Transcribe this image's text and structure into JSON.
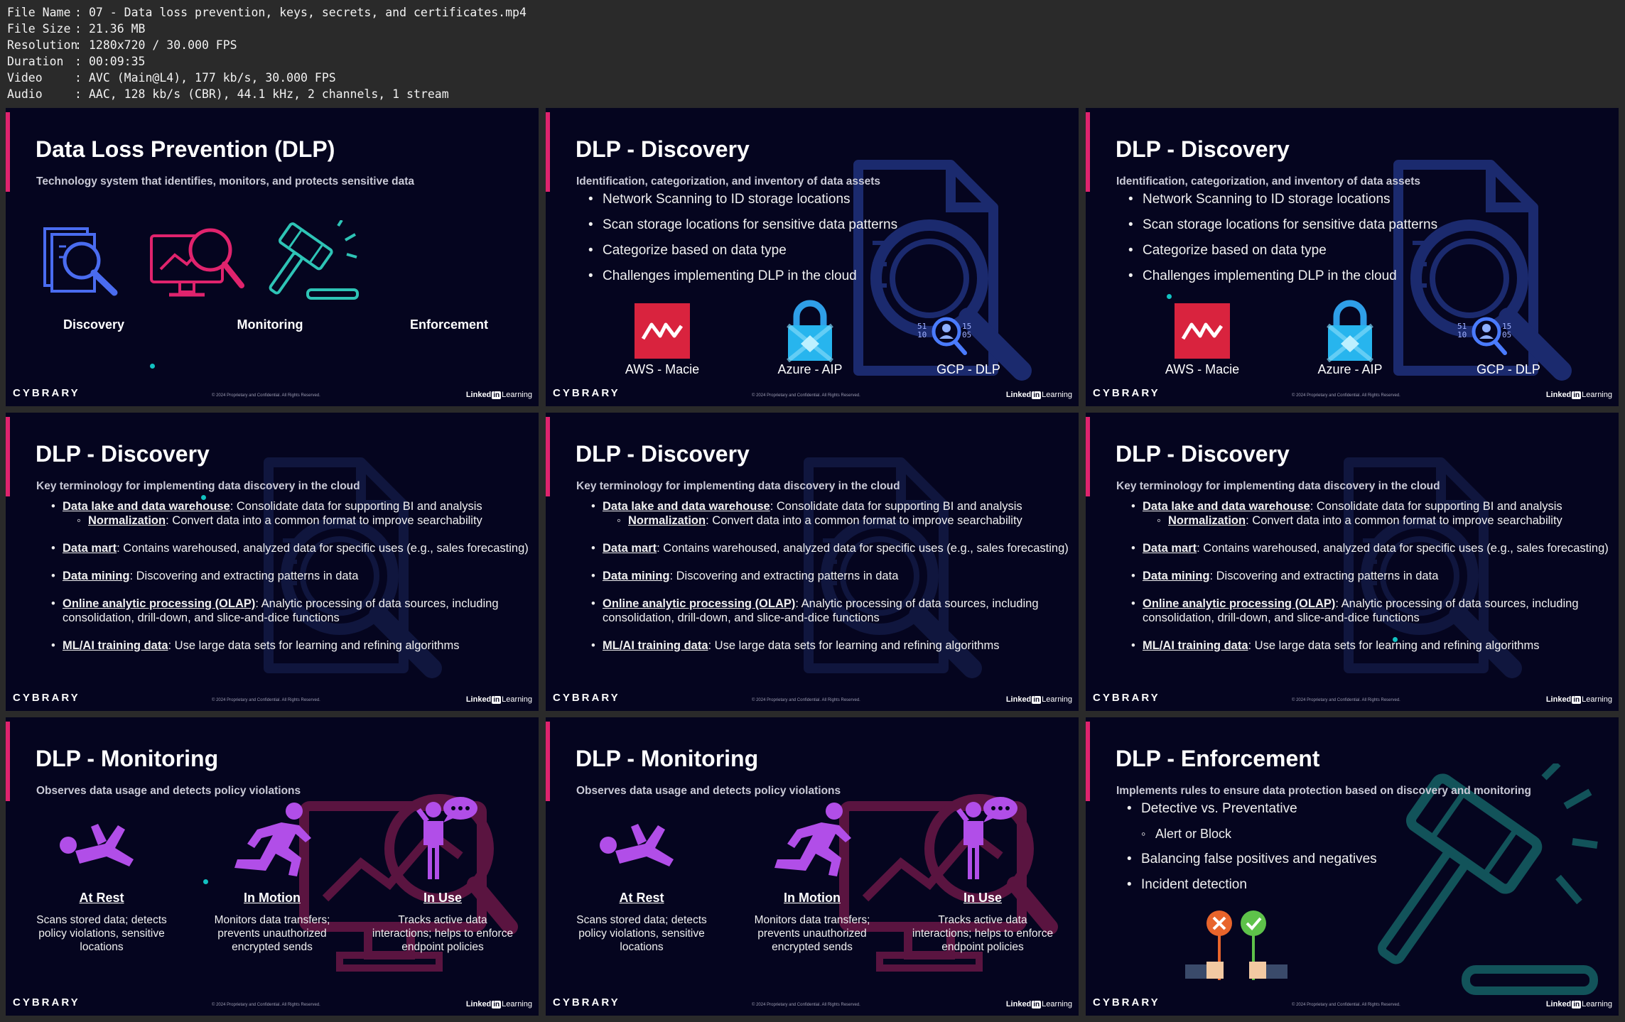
{
  "file_info": [
    {
      "label": "File Name",
      "value": "07 - Data loss prevention, keys, secrets, and certificates.mp4"
    },
    {
      "label": "File Size",
      "value": "21.36 MB"
    },
    {
      "label": "Resolution",
      "value": "1280x720 / 30.000 FPS"
    },
    {
      "label": "Duration",
      "value": "00:09:35"
    },
    {
      "label": "Video",
      "value": "AVC (Main@L4), 177 kb/s, 30.000 FPS"
    },
    {
      "label": "Audio",
      "value": "AAC, 128 kb/s (CBR), 44.1 kHz, 2 channels, 1 stream"
    }
  ],
  "footer": {
    "logo": "CYBRARY",
    "copyright": "© 2024 Proprietary and Confidential. All Rights Reserved.",
    "linkedin_a": "Linked",
    "linkedin_in": "in",
    "linkedin_b": "Learning"
  },
  "slide1": {
    "title": "Data Loss Prevention (DLP)",
    "subtitle": "Technology system that identifies, monitors, and protects sensitive data",
    "captions": [
      "Discovery",
      "Monitoring",
      "Enforcement"
    ]
  },
  "discovery_overview": {
    "title": "DLP - Discovery",
    "subtitle": "Identification, categorization, and inventory of data assets",
    "bullets": [
      "Network Scanning to ID storage locations",
      "Scan storage locations for sensitive data patterns",
      "Categorize based on data type",
      "Challenges implementing DLP in the cloud"
    ],
    "providers": [
      "AWS - Macie",
      "Azure - AIP",
      "GCP - DLP"
    ],
    "gcp_digits": [
      "51",
      "10",
      "15",
      "05"
    ]
  },
  "discovery_terms": {
    "title": "DLP - Discovery",
    "subtitle": "Key terminology for implementing data discovery in the cloud",
    "terms": [
      {
        "term": "Data lake and data warehouse",
        "desc": ": Consolidate data for supporting BI and analysis",
        "sub_term": "Normalization",
        "sub_desc": ": Convert data into a common format to improve searchability"
      },
      {
        "term": "Data mart",
        "desc": ": Contains warehoused, analyzed data for specific uses (e.g., sales forecasting)"
      },
      {
        "term": "Data mining",
        "desc": ": Discovering and extracting patterns in data"
      },
      {
        "term": "Online analytic processing (OLAP)",
        "desc": ": Analytic processing of data sources, including consolidation, drill-down, and slice-and-dice functions"
      },
      {
        "term": "ML/AI training data",
        "desc": ": Use large data sets for learning and refining algorithms"
      }
    ]
  },
  "monitoring": {
    "title": "DLP - Monitoring",
    "subtitle": "Observes data usage and detects policy violations",
    "items": [
      {
        "head": "At Rest",
        "desc": "Scans stored data; detects policy violations, sensitive locations"
      },
      {
        "head": "In Motion",
        "desc": "Monitors data transfers; prevents unauthorized encrypted sends"
      },
      {
        "head": "In Use",
        "desc": "Tracks active data interactions; helps to enforce endpoint policies"
      }
    ]
  },
  "enforcement": {
    "title": "DLP - Enforcement",
    "subtitle": "Implements rules to ensure data protection based on discovery and monitoring",
    "bullets": [
      {
        "text": "Detective vs. Preventative",
        "sub": false
      },
      {
        "text": "Alert or Block",
        "sub": true
      },
      {
        "text": "Balancing false positives and negatives",
        "sub": false
      },
      {
        "text": "Incident detection",
        "sub": false
      }
    ]
  },
  "colors": {
    "background": "#05051f",
    "accent_bar": "#e0236d",
    "discovery_icon": "#4a6cf0",
    "monitoring_icon": "#e0236d",
    "enforcement_icon": "#2ec4b6",
    "people_icon": "#b14ee8",
    "bg_watermark_blue": "#1b2a6e",
    "bg_watermark_magenta": "#5a1440",
    "bg_watermark_teal": "#12535a"
  }
}
